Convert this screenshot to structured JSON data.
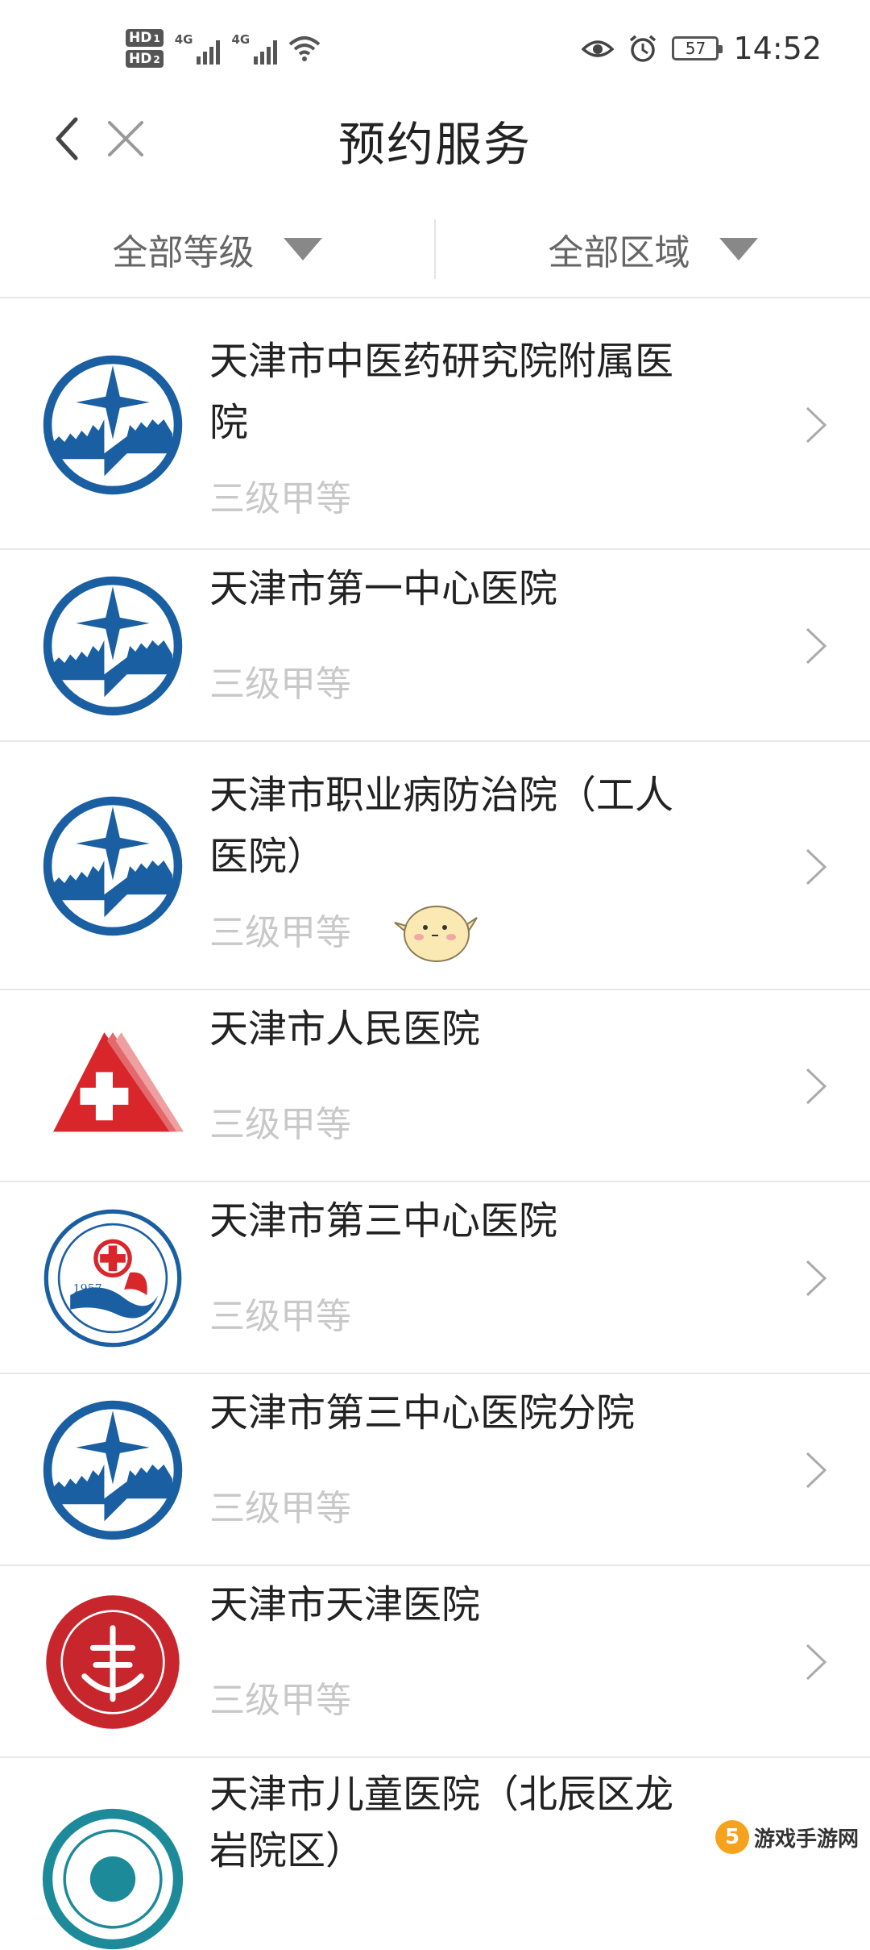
{
  "status_bar": {
    "hd1": "HD",
    "hd1_num": "1",
    "hd2": "HD",
    "hd2_num": "2",
    "net1": "4G",
    "net2": "4G",
    "battery": "57",
    "time": "14:52",
    "icons": [
      "hd-icon",
      "signal-icon",
      "signal-icon",
      "wifi-icon",
      "eye-icon",
      "alarm-icon",
      "battery-icon"
    ]
  },
  "nav": {
    "title": "预约服务",
    "icons": [
      "back-icon",
      "close-icon"
    ]
  },
  "filters": [
    {
      "label": "全部等级"
    },
    {
      "label": "全部区域"
    }
  ],
  "hospitals": [
    {
      "name": "天津市中医药研究院附属医院",
      "level": "三级甲等",
      "logo": "great-wall-star-logo"
    },
    {
      "name": "天津市第一中心医院",
      "level": "三级甲等",
      "logo": "great-wall-star-logo"
    },
    {
      "name": "天津市职业病防治院（工人医院）",
      "level": "三级甲等",
      "logo": "great-wall-star-logo"
    },
    {
      "name": "天津市人民医院",
      "level": "三级甲等",
      "logo": "red-cross-triangle-logo"
    },
    {
      "name": "天津市第三中心医院",
      "level": "三级甲等",
      "logo": "third-central-hospital-seal",
      "logo_text": "1957"
    },
    {
      "name": "天津市第三中心医院分院",
      "level": "三级甲等",
      "logo": "great-wall-star-logo"
    },
    {
      "name": "天津市天津医院",
      "level": "三级甲等",
      "logo": "tianjin-hospital-red-seal"
    },
    {
      "name": "天津市儿童医院（北辰区龙岩院区）",
      "level": "",
      "logo": "childrens-hospital-seal"
    }
  ],
  "watermark": {
    "badge": "5",
    "text": "游戏手游网"
  },
  "colors": {
    "logo_blue": "#1b5fa3",
    "cross_red": "#d8262b",
    "level_gray": "#c8c8c8",
    "divider": "#e8e8e8"
  }
}
